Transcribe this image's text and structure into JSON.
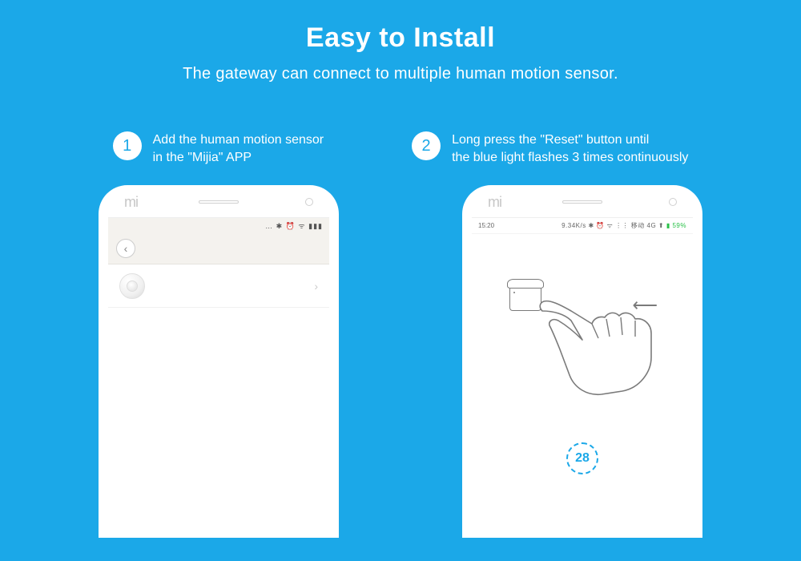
{
  "header": {
    "title": "Easy to Install",
    "subtitle": "The gateway can connect to multiple human motion sensor."
  },
  "steps": [
    {
      "num": "1",
      "line1": "Add the human motion sensor",
      "line2": "in the \"Mijia\" APP"
    },
    {
      "num": "2",
      "line1": "Long press the \"Reset\" button until",
      "line2": "the blue light flashes 3 times continuously"
    }
  ],
  "phone1": {
    "logo": "mi",
    "status_icons": "… ✱ ⏰ ᯤ ▮▮▮"
  },
  "phone2": {
    "logo": "mi",
    "status_time": "15:20",
    "status_right_text": "9.34K/s ✱ ⏰ ᯤ  ⋮⋮ 移动 4G ⬆",
    "status_battery": "▮ 59%",
    "countdown": "28"
  }
}
